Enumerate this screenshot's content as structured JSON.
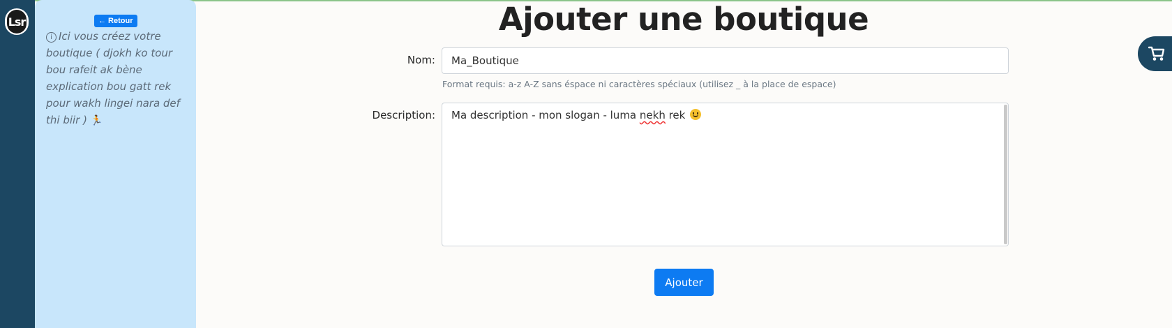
{
  "app": {
    "logo_text": "Lsr"
  },
  "sidebar": {
    "back_label": "← Retour",
    "info_text": "Ici vous créez votre boutique ( djokh ko tour bou rafeit ak bène explication bou gatt rek pour wakh lingei nara def thi biir )"
  },
  "page": {
    "title": "Ajouter une boutique"
  },
  "form": {
    "name_label": "Nom:",
    "name_value": "Ma_Boutique",
    "name_hint": "Format requis: a-z A-Z sans éspace ni caractères spéciaux (utilisez _ à la place de espace)",
    "description_label": "Description:",
    "description_value_prefix": "Ma description - mon slogan - luma ",
    "description_value_misspelled": "nekh",
    "description_value_suffix": " rek",
    "submit_label": "Ajouter"
  },
  "colors": {
    "accent": "#0d7bf2",
    "sidebar_bg": "#1c4762",
    "info_panel_bg": "#c8e6fb"
  },
  "icons": {
    "info": "info-circle-icon",
    "runner": "running-person-emoji",
    "smile": "smiling-face-emoji",
    "cart": "shopping-cart-icon"
  }
}
